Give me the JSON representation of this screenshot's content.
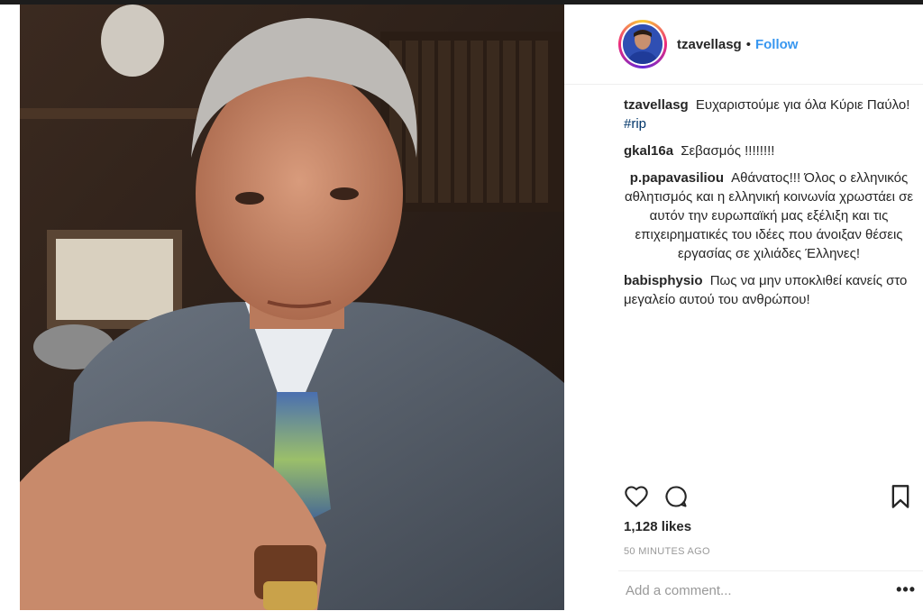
{
  "post": {
    "username": "tzavellasg",
    "separator": "•",
    "follow_label": "Follow"
  },
  "caption": {
    "user": "tzavellasg",
    "text": "Ευχαριστούμε για όλα Κύριε Παύλο!",
    "hashtag": "#rip"
  },
  "comments": [
    {
      "user": "gkal16a",
      "text": "Σεβασμός !!!!!!!!"
    },
    {
      "user": "p.papavasiliou",
      "text": "Αθάνατος!!! Όλος ο ελληνικός αθλητισμός και η ελληνική κοινωνία χρωστάει σε αυτόν την ευρωπαϊκή μας εξέλιξη και τις επιχειρηματικές του ιδέες που άνοιξαν θέσεις εργασίας σε χιλιάδες Έλληνες!"
    },
    {
      "user": "babisphysio",
      "text": "Πως να μην υποκλιθεί κανείς στο μεγαλείο αυτού του ανθρώπου!"
    }
  ],
  "likes": "1,128 likes",
  "time_ago": "50 MINUTES AGO",
  "comment_box": {
    "placeholder": "Add a comment..."
  },
  "more_label": "•••",
  "icons": {
    "like": "heart-icon",
    "comment": "comment-bubble-icon",
    "save": "bookmark-icon"
  },
  "colors": {
    "link": "#3897f0",
    "hashtag": "#003569",
    "muted": "#999999"
  }
}
